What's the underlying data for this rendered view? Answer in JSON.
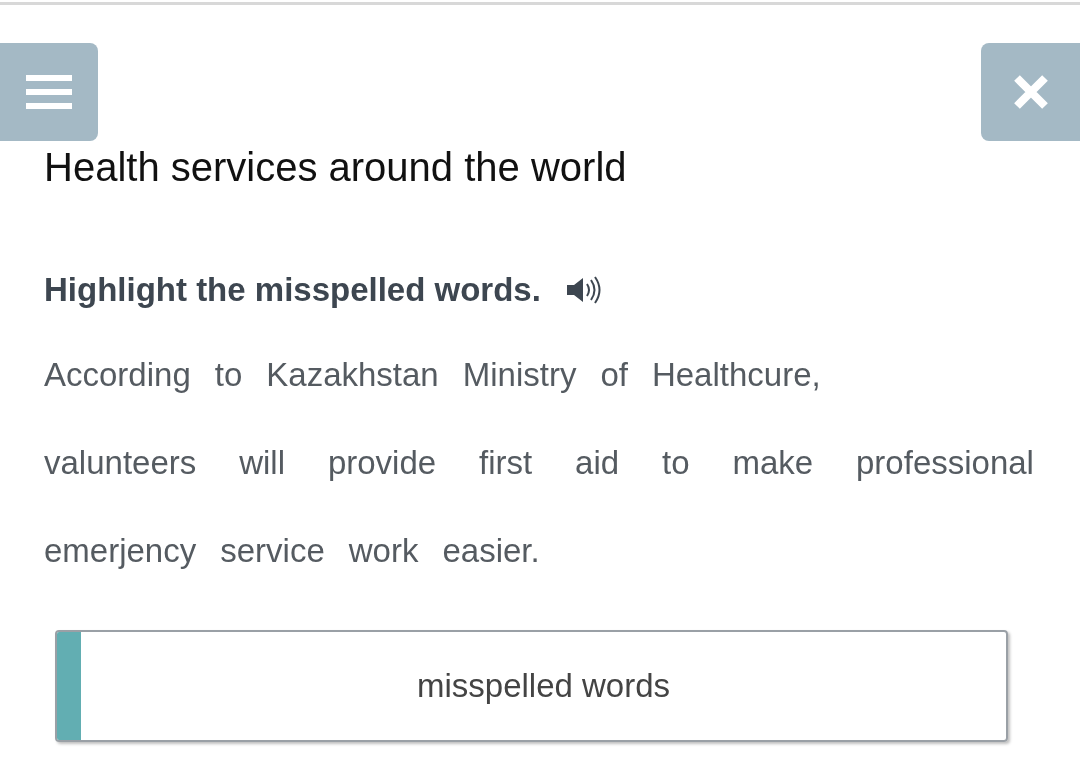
{
  "title": "Health services around the world",
  "instruction": "Highlight the misspelled words.",
  "lines": [
    [
      {
        "text": "According",
        "selected": false
      },
      {
        "text": "to",
        "selected": false
      },
      {
        "text": "Kazakhstan",
        "selected": false
      },
      {
        "text": "Ministry",
        "selected": false
      },
      {
        "text": "of",
        "selected": false
      },
      {
        "text": "Healthcure,",
        "selected": false
      }
    ],
    [
      {
        "text": "valunteers",
        "selected": false
      },
      {
        "text": "will",
        "selected": false
      },
      {
        "text": "provide",
        "selected": false
      },
      {
        "text": "first",
        "selected": false
      },
      {
        "text": "aid",
        "selected": false
      },
      {
        "text": "to",
        "selected": false
      },
      {
        "text": "make",
        "selected": false
      },
      {
        "text": "professional",
        "selected": false
      }
    ],
    [
      {
        "text": "emerjency",
        "selected": false
      },
      {
        "text": "service",
        "selected": false
      },
      {
        "text": "work",
        "selected": false
      },
      {
        "text": "easier.",
        "selected": false
      }
    ]
  ],
  "answer_box": {
    "label": "misspelled words"
  }
}
